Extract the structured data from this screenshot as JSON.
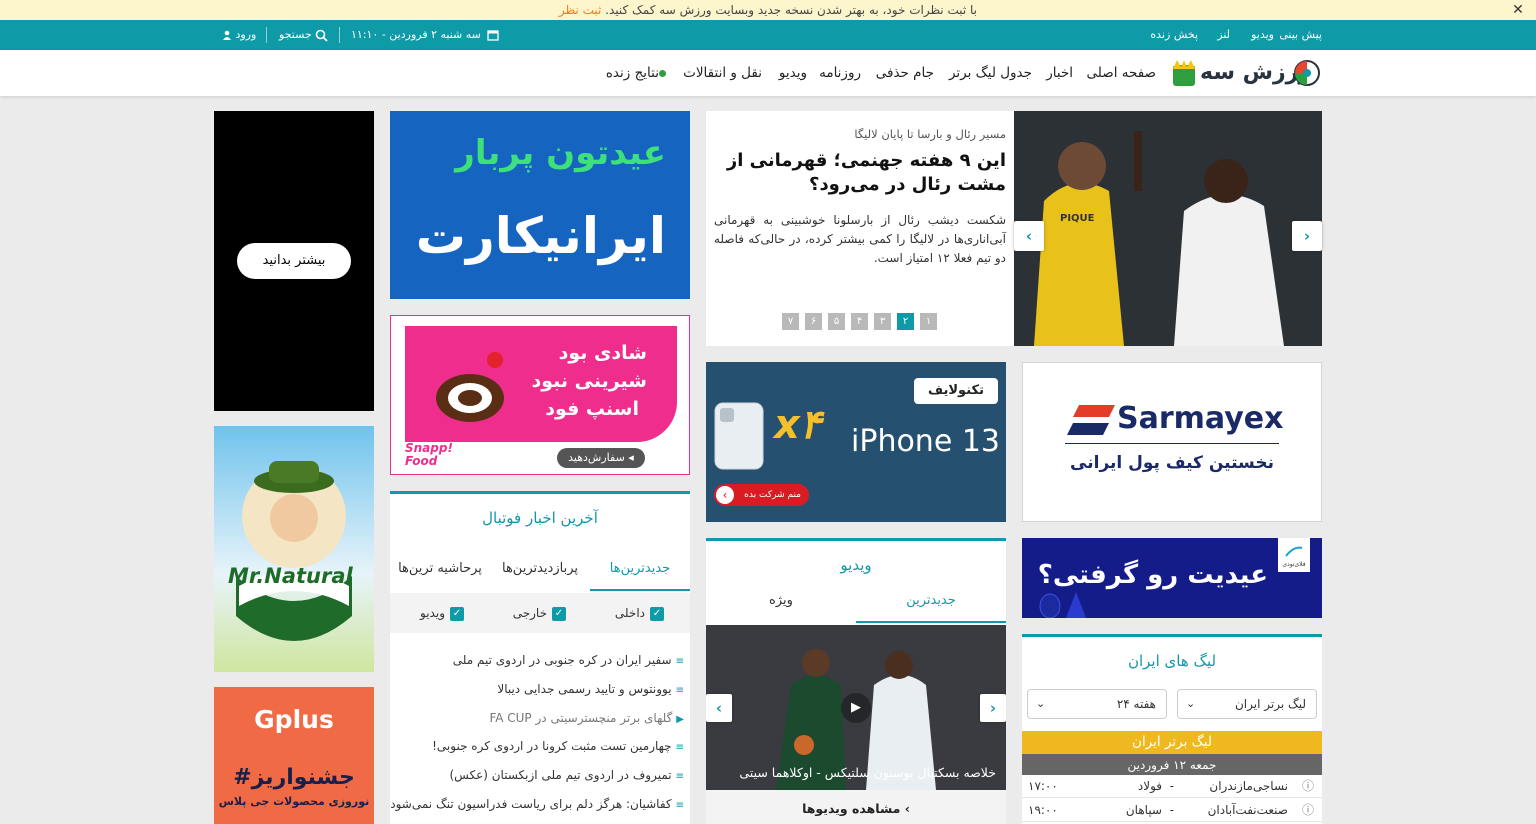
{
  "notice": {
    "text": "با ثبت نظرات خود، به بهتر شدن نسخه جدید وبسایت ورزش سه کمک کنید.",
    "link": "ثبت نظر",
    "close": "✕"
  },
  "topbar": {
    "right_links": [
      "پیش بینی",
      "ویدیو",
      "لنز",
      "پخش زنده"
    ],
    "date": "سه شنبه ۲ فروردین - ۱۱:۱۰",
    "search": "جستجو",
    "login": "ورود"
  },
  "nav": {
    "logo_text": "ورزش سه",
    "items": [
      "صفحه اصلی",
      "اخبار",
      "جدول لیگ برتر",
      "جام حذفی",
      "روزنامه",
      "ویدیو",
      "نقل و انتقالات",
      "نتایج زنده"
    ]
  },
  "hero": {
    "kicker": "مسیر رئال و بارسا تا پایان لالیگا",
    "title": "این ۹ هفته جهنمی؛ قهرمانی از مشت رئال در می‌رود؟",
    "summary": "شکست دیشب رئال از بارسلونا خوشبینی به قهرمانی آبی‌اناری‌ها در لالیگا را کمی بیشتر کرده، در حالی‌که فاصله دو تیم فعلا ۱۲ امتیاز است.",
    "pages": [
      "۷",
      "۶",
      "۵",
      "۴",
      "۳",
      "۲",
      "۱"
    ],
    "active_page": "۲",
    "photo_text": "PIQUE"
  },
  "ads": {
    "black_button": "بیشتر بدانید",
    "iranicard_line1": "عیدتون پربار",
    "iranicard_line2": "ایرانیکارت",
    "snapp_lines": [
      "شادی بود",
      "شیرینی نبود",
      "اسنپ فود"
    ],
    "snapp_button": "سفارش‌دهید ◂",
    "snapp_brand": "Snapp! Food",
    "tecno_brand": "تکنولایف",
    "tecno_x": "x۴",
    "tecno_phone": "iPhone 13",
    "tecno_button": "منم شرکت بده",
    "sarmayex_brand": "Sarmayex",
    "sarmayex_tag": "نخستین کیف پول ایرانی",
    "mrnatural": "Mr.Natural",
    "gplus_brand": "Gplus",
    "gplus_title": "#جشنواریز",
    "gplus_sub": "نوروزی محصولات جی پلاس",
    "eid_title": "عیدیت رو گرفتی؟",
    "eid_brand": "فلای‌تودی"
  },
  "football_news": {
    "title": "آخرین اخبار فوتبال",
    "tabs": [
      "جدیدترین‌ها",
      "پربازدیدترین‌ها",
      "پرحاشیه ترین‌ها"
    ],
    "filters": [
      "داخلی",
      "خارجی",
      "ویدیو"
    ],
    "items": [
      {
        "text": "سفیر ایران در کره جنوبی در اردوی تیم ملی",
        "icon": "≡",
        "muted": false
      },
      {
        "text": "یوونتوس و تایید رسمی جدایی دیبالا",
        "icon": "≡",
        "muted": false
      },
      {
        "text": "گلهای برتر منچسترسیتی در FA CUP",
        "icon": "▶",
        "muted": true
      },
      {
        "text": "چهارمین تست مثبت کرونا در اردوی کره جنوبی!",
        "icon": "≡",
        "muted": false
      },
      {
        "text": "تمیروف در اردوی تیم ملی ازبکستان (عکس)",
        "icon": "≡",
        "muted": false
      },
      {
        "text": "کفاشیان: هرگز دلم برای ریاست فدراسیون تنگ نمی‌شود",
        "icon": "≡",
        "muted": false
      }
    ]
  },
  "video": {
    "title": "ویدیو",
    "tabs": [
      "جدیدترین",
      "ویژه"
    ],
    "caption": "خلاصه بسکتبال بوستون سلتیکس - اوکلاهما سیتی",
    "more": "مشاهده ویدیوها"
  },
  "leagues": {
    "title": "لیگ های ایران",
    "league_select": "لیگ برتر ایران",
    "week_select": "هفته ۲۴",
    "league_header": "لیگ برتر ایران",
    "date_header": "جمعه ۱۲ فروردین",
    "matches": [
      {
        "home": "نساجی‌مازندران",
        "away": "فولاد",
        "time": "۱۷:۰۰"
      },
      {
        "home": "صنعت‌نفت‌آبادان",
        "away": "سپاهان",
        "time": "۱۹:۰۰"
      }
    ]
  },
  "colors": {
    "teal": "#0f9aa8",
    "iranicard_blue": "#1565c0",
    "snapp_pink": "#ef2d8c",
    "tecno_blue": "#26506f",
    "sarmayex_navy": "#1a2a66",
    "league_yellow": "#f0b820",
    "gplus_orange": "#f06b45",
    "eid_navy": "#141c8a"
  }
}
